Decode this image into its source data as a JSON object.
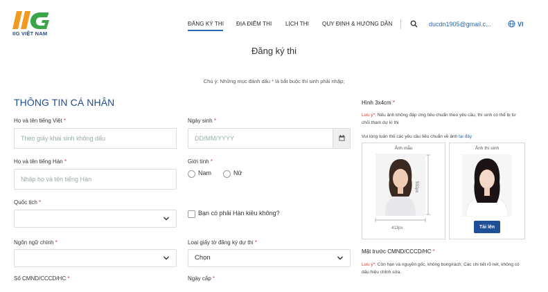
{
  "header": {
    "logo_text": "IIG VIỆT NAM",
    "nav": [
      "ĐĂNG KÝ THI",
      "ĐỊA ĐIỂM THI",
      "LỊCH THI",
      "QUY ĐỊNH & HƯỚNG DẪN"
    ],
    "active_nav": 0,
    "email": "ducdn1905@gmail.c...",
    "language": "VI"
  },
  "page_title": "Đăng ký thi",
  "note": "Chú ý: Những mục đánh dấu * là bắt buộc thí sinh phải nhập;",
  "section_title": "THÔNG TIN CÁ NHÂN",
  "form": {
    "name_vi_label": "Họ và tên tiếng Việt",
    "name_vi_placeholder": "Theo giấy khai sinh không dấu",
    "dob_label": "Ngày sinh",
    "dob_placeholder": "DD/MM/YYYY",
    "name_kr_label": "Họ và tên tiếng Hàn",
    "name_kr_placeholder": "Nhập họ và tên tiếng Hàn",
    "gender_label": "Giới tính",
    "gender_options": [
      "Nam",
      "Nữ"
    ],
    "nationality_label": "Quốc tịch",
    "nationality_value": "",
    "korean_overseas_label": "Bạn có phải Hàn kiều không?",
    "language_label": "Ngôn ngữ chính",
    "language_value": "",
    "doc_type_label": "Loại giấy tờ đăng ký dự thi",
    "doc_type_value": "Chọn",
    "id_number_label": "Số CMND/CCCD/HC",
    "issue_date_label": "Ngày cấp",
    "required_mark": "*"
  },
  "photo": {
    "title": "Hình 3x4cm",
    "warning_prefix": "Lưu ý*:",
    "warning_text": " Nếu ảnh không đáp ứng tiêu chuẩn theo yêu cầu, thí sinh có thể bị từ chối tham dự kì thi",
    "guide_text": "Vui lòng tuân thủ các yêu cầu tiêu chuẩn về ảnh ",
    "guide_link": "tại đây",
    "sample_caption": "Ảnh mẫu",
    "candidate_caption": "Ảnh thí sinh",
    "width_label": "413px",
    "height_label": "531px",
    "upload_label": "Tải lên"
  },
  "cmnd": {
    "title": "Mặt trước CMND/CCCD/HC",
    "warning_prefix": "Lưu ý*:",
    "warning_text": " Còn hạn và nguyên gốc, không bong/rách; Các chi tiết rõ nét, không có dấu hiệu chỉnh sửa."
  },
  "colors": {
    "brand_blue": "#1e4c8c",
    "accent": "#2a68b8",
    "logo_orange": "#f29a1f",
    "logo_green": "#3aa648",
    "required_red": "#d23c3c"
  }
}
